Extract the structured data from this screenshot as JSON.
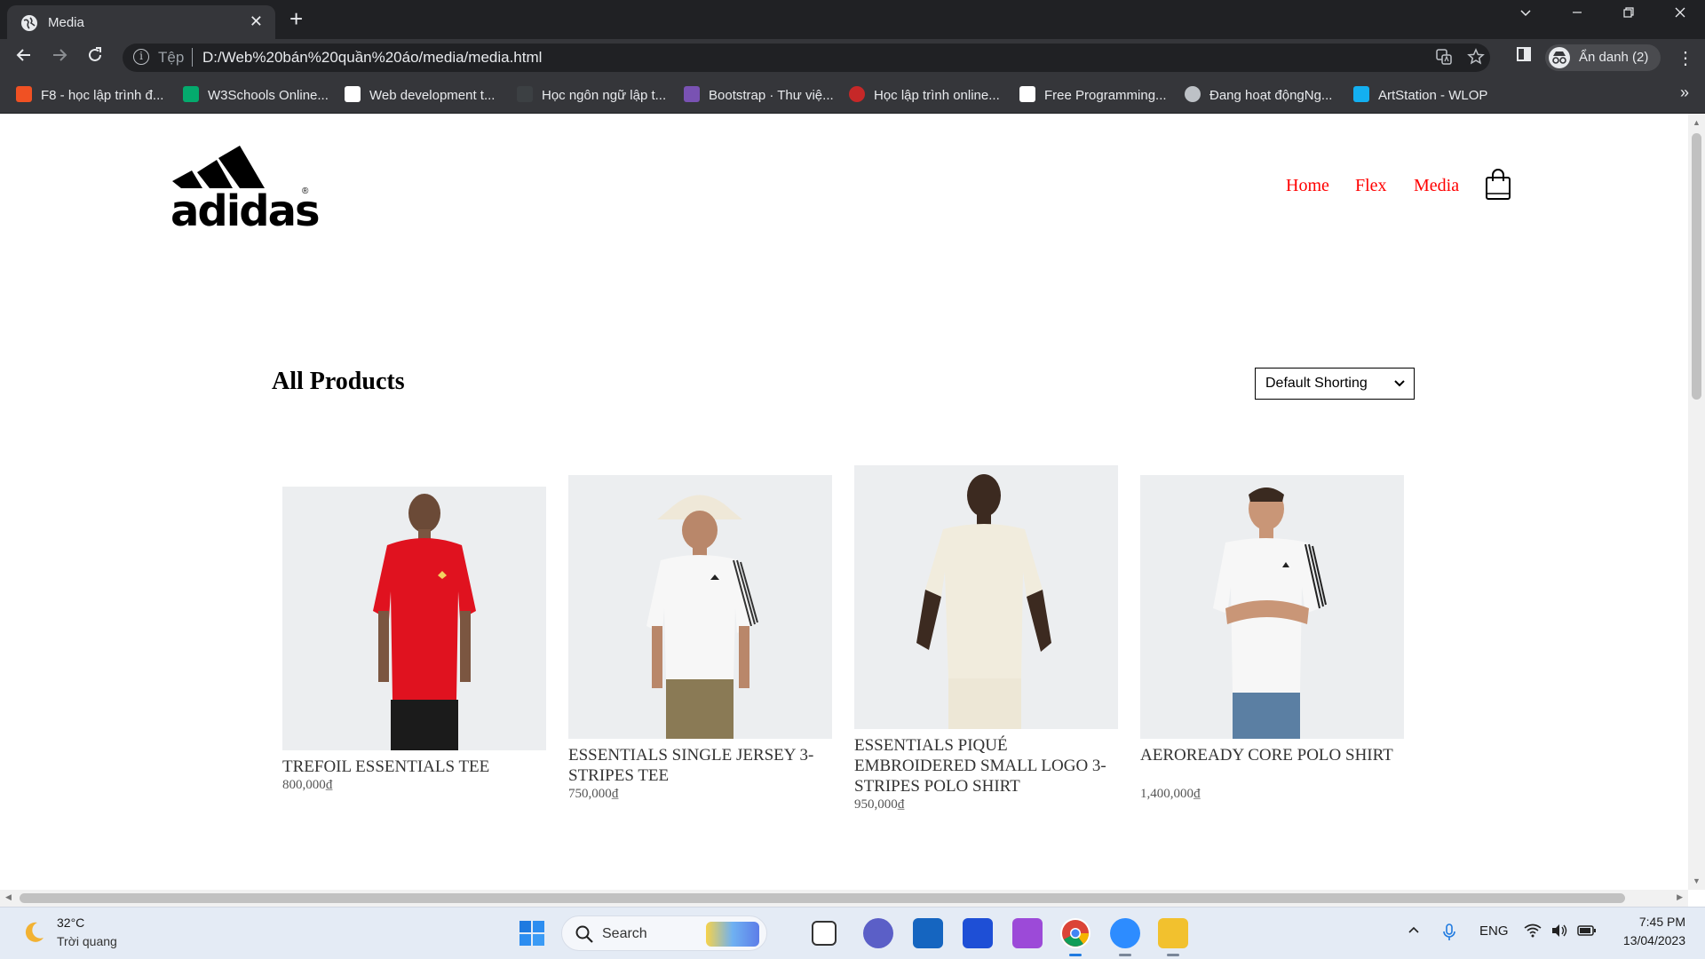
{
  "browser": {
    "tab_title": "Media",
    "tab_close": "✕",
    "new_tab": "+",
    "omnibox_scheme": "Tệp",
    "omnibox_url": "D:/Web%20bán%20quần%20áo/media/media.html",
    "profile_label": "Ẩn danh (2)",
    "bookmarks": [
      {
        "label": "F8 - học lập trình đ...",
        "icon": "f8-icon",
        "color": "#f05123"
      },
      {
        "label": "W3Schools Online...",
        "icon": "w3schools-icon",
        "color": "#04aa6d"
      },
      {
        "label": "Web development t...",
        "icon": "w3c-icon",
        "color": "#ffffff"
      },
      {
        "label": "Học ngôn ngữ lập t...",
        "icon": "dark-page-icon",
        "color": "#3c4043"
      },
      {
        "label": "Bootstrap · Thư việ...",
        "icon": "bootstrap-icon",
        "color": "#7952b3"
      },
      {
        "label": "Học lập trình online...",
        "icon": "red-arc-icon",
        "color": "#c62828"
      },
      {
        "label": "Free Programming...",
        "icon": "freecodecamp-icon",
        "color": "#ffffff"
      },
      {
        "label": "Đang hoạt độngNg...",
        "icon": "globe-icon",
        "color": "#bdc1c6"
      },
      {
        "label": "ArtStation - WLOP",
        "icon": "artstation-icon",
        "color": "#13aff0"
      }
    ],
    "bookmarks_more": "»"
  },
  "site": {
    "logo_text": "adidas",
    "logo_reg": "®",
    "nav": [
      "Home",
      "Flex",
      "Media"
    ],
    "nav_color": "#ff0000",
    "section_title": "All Products",
    "sort_selected": "Default Shorting"
  },
  "products": [
    {
      "name": "TREFOIL ESSENTIALS TEE",
      "price": "800,000₫",
      "shirt_color": "#e0121f",
      "pants_color": "#1b1b1b"
    },
    {
      "name": "ESSENTIALS SINGLE JERSEY 3-STRIPES TEE",
      "price": "750,000₫",
      "shirt_color": "#f7f7f7",
      "pants_color": "#8a7a55"
    },
    {
      "name": "ESSENTIALS PIQUÉ EMBROIDERED SMALL LOGO 3-STRIPES POLO SHIRT",
      "price": "950,000₫",
      "shirt_color": "#f1ecdd",
      "pants_color": "#ede7d6"
    },
    {
      "name": "AEROREADY CORE POLO SHIRT",
      "price": "1,400,000₫",
      "shirt_color": "#f7f7f7",
      "pants_color": "#5b7fa3"
    }
  ],
  "taskbar": {
    "temperature": "32°C",
    "weather": "Trời quang",
    "search_placeholder": "Search",
    "language": "ENG",
    "time": "7:45 PM",
    "date": "13/04/2023"
  }
}
